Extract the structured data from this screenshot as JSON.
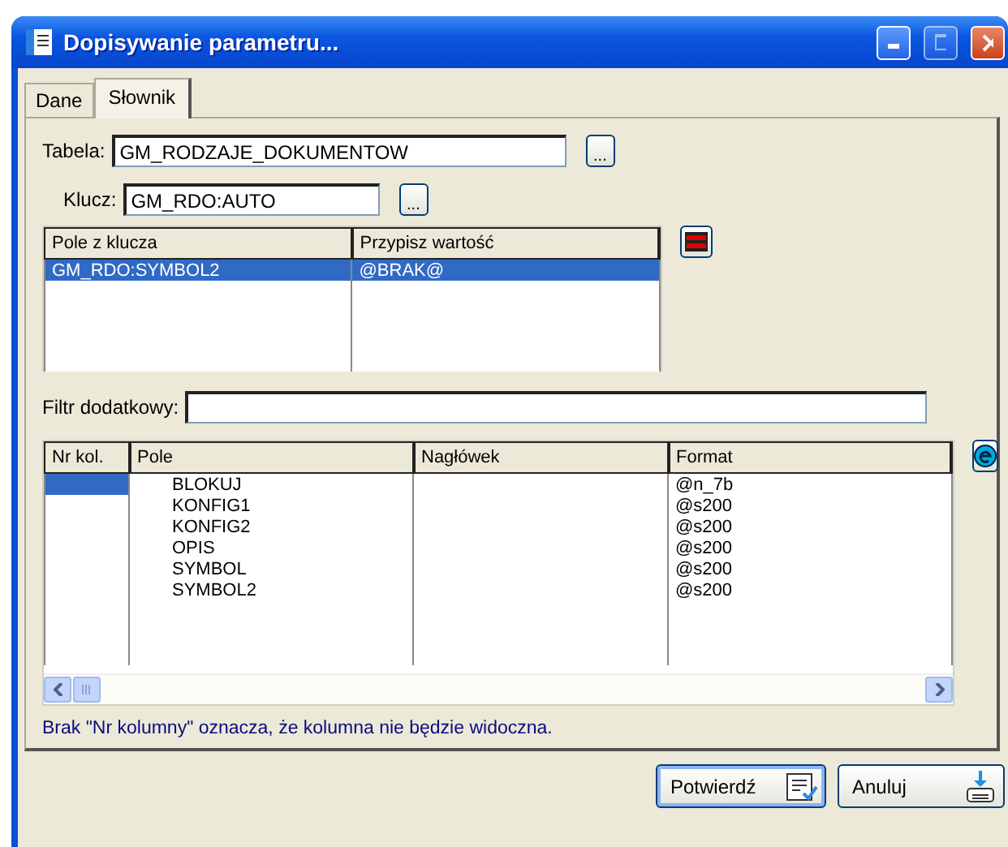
{
  "window": {
    "title": "Dopisywanie parametru..."
  },
  "tabs": [
    {
      "label": "Dane",
      "selected": false
    },
    {
      "label": "Słownik",
      "selected": true
    }
  ],
  "tabela": {
    "label": "Tabela:",
    "value": "GM_RODZAJE_DOKUMENTOW",
    "button": "..."
  },
  "klucz": {
    "label": "Klucz:",
    "value": "GM_RDO:AUTO",
    "button": "..."
  },
  "key_table": {
    "columns": [
      "Pole z klucza",
      "Przypisz wartość"
    ],
    "rows": [
      {
        "cells": [
          "GM_RDO:SYMBOL2",
          "@BRAK@"
        ],
        "selected": true
      }
    ]
  },
  "filter": {
    "label": "Filtr dodatkowy:"
  },
  "fields_table": {
    "columns": [
      "Nr kol.",
      "Pole",
      "Nagłówek",
      "Format"
    ],
    "rows": [
      {
        "cells": [
          "",
          "BLOKUJ",
          "",
          "@n_7b"
        ],
        "selected": true
      },
      {
        "cells": [
          "",
          "KONFIG1",
          "",
          "@s200"
        ],
        "selected": false
      },
      {
        "cells": [
          "",
          "KONFIG2",
          "",
          "@s200"
        ],
        "selected": false
      },
      {
        "cells": [
          "",
          "OPIS",
          "",
          "@s200"
        ],
        "selected": false
      },
      {
        "cells": [
          "",
          "SYMBOL",
          "",
          "@s200"
        ],
        "selected": false
      },
      {
        "cells": [
          "",
          "SYMBOL2",
          "",
          "@s200"
        ],
        "selected": false
      }
    ]
  },
  "note": "Brak \"Nr kolumny\" oznacza, że kolumna nie będzie widoczna.",
  "buttons": [
    {
      "label": "Potwierdź",
      "kind": "confirm"
    },
    {
      "label": "Anuluj",
      "kind": "cancel"
    }
  ]
}
